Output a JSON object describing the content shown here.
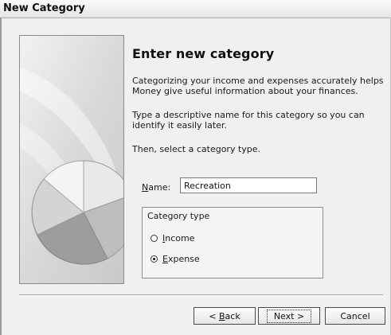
{
  "window": {
    "title": "New Category"
  },
  "main": {
    "heading": "Enter new category",
    "paragraphs": [
      "Categorizing your income and expenses accurately helps Money give useful information about your finances.",
      "Type a descriptive name for this category so you can identify it easily later.",
      "Then, select a category type."
    ],
    "name_label_accel": "N",
    "name_label_rest": "ame:",
    "name_value": "Recreation",
    "category_type": {
      "title": "Category type",
      "options": [
        {
          "accel_prefix": "",
          "accel": "I",
          "rest": "ncome",
          "selected": false
        },
        {
          "accel_prefix": "",
          "accel": "E",
          "rest": "xpense",
          "selected": true
        }
      ]
    }
  },
  "buttons": {
    "back_prefix": "< ",
    "back_accel": "B",
    "back_rest": "ack",
    "next": "Next >",
    "cancel": "Cancel"
  },
  "icons": {
    "wizard_art": "pie-chart-illustration"
  }
}
